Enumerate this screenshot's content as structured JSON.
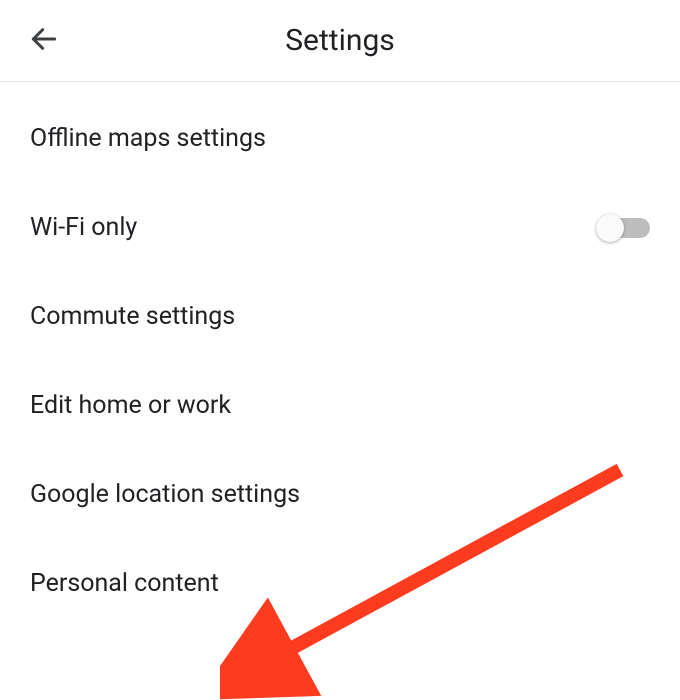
{
  "header": {
    "title": "Settings"
  },
  "items": [
    {
      "label": "Offline maps settings",
      "has_toggle": false
    },
    {
      "label": "Wi-Fi only",
      "has_toggle": true,
      "toggle_on": false
    },
    {
      "label": "Commute settings",
      "has_toggle": false
    },
    {
      "label": "Edit home or work",
      "has_toggle": false
    },
    {
      "label": "Google location settings",
      "has_toggle": false
    },
    {
      "label": "Personal content",
      "has_toggle": false
    }
  ],
  "annotation": {
    "arrow_color": "#fd3b1f"
  }
}
